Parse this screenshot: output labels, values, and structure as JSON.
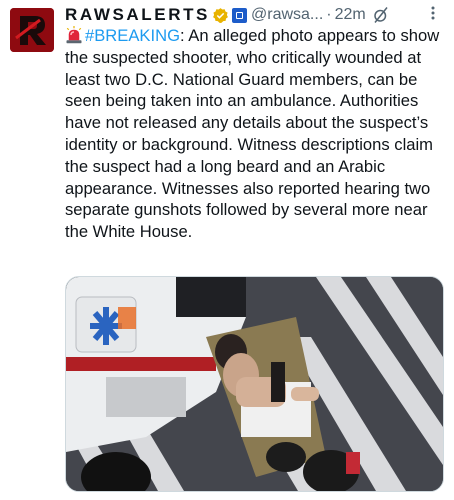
{
  "author": {
    "name": "RAWSALERTS",
    "handle": "@rawsa...",
    "time": "22m",
    "separator": "·"
  },
  "tweet": {
    "hashtag": "#BREAKING",
    "body": ": An alleged photo appears to show the suspected shooter, who critically wounded at least two D.C. National Guard members, can be seen being taken into an ambulance. Authorities have not released any details about the suspect’s identity or background. Witness descriptions claim the suspect had a long beard and an Arabic appearance. Witnesses also reported hearing two separate gunshots followed by several more near the White House."
  },
  "icons": {
    "avatar": "raws-logo-icon",
    "verified": "verified-badge-icon",
    "affiliation": "affiliation-icon",
    "grok": "grok-icon",
    "more": "more-icon",
    "siren": "siren-icon"
  },
  "colors": {
    "link": "#1d9bf0",
    "verified": "#e8b300",
    "avatar_bg": "#9b0d12",
    "secondary_text": "#536471"
  }
}
